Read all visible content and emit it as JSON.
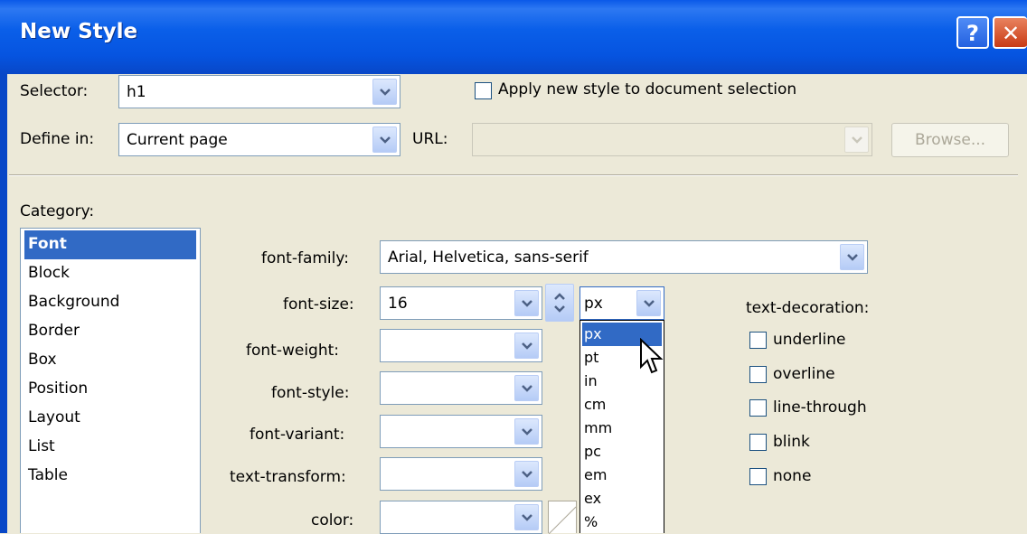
{
  "window": {
    "title": "New Style",
    "help_label": "?",
    "close_label": "✕"
  },
  "selector": {
    "label": "Selector:",
    "value": "h1"
  },
  "apply_checkbox": {
    "label": "Apply new style to document selection",
    "checked": false
  },
  "define_in": {
    "label": "Define in:",
    "value": "Current page"
  },
  "url": {
    "label": "URL:",
    "value": ""
  },
  "browse_button": {
    "label": "Browse..."
  },
  "category": {
    "label": "Category:",
    "items": [
      "Font",
      "Block",
      "Background",
      "Border",
      "Box",
      "Position",
      "Layout",
      "List",
      "Table"
    ],
    "selected": "Font"
  },
  "font": {
    "family_label": "font-family:",
    "family_value": "Arial, Helvetica, sans-serif",
    "size_label": "font-size:",
    "size_value": "16",
    "size_unit": "px",
    "weight_label": "font-weight:",
    "weight_value": "",
    "style_label": "font-style:",
    "style_value": "",
    "variant_label": "font-variant:",
    "variant_value": "",
    "transform_label": "text-transform:",
    "transform_value": "",
    "color_label": "color:",
    "color_value": ""
  },
  "unit_options": [
    "px",
    "pt",
    "in",
    "cm",
    "mm",
    "pc",
    "em",
    "ex",
    "%"
  ],
  "unit_highlighted": "px",
  "text_decoration": {
    "label": "text-decoration:",
    "options": [
      "underline",
      "overline",
      "line-through",
      "blink",
      "none"
    ]
  },
  "colors": {
    "titlebar": "#0a5fe9",
    "dialog_bg": "#ece9d8",
    "selection": "#316ac5"
  },
  "icons": [
    "help-icon",
    "close-icon",
    "chevron-down-icon",
    "spinner-icon",
    "mouse-cursor-icon"
  ]
}
